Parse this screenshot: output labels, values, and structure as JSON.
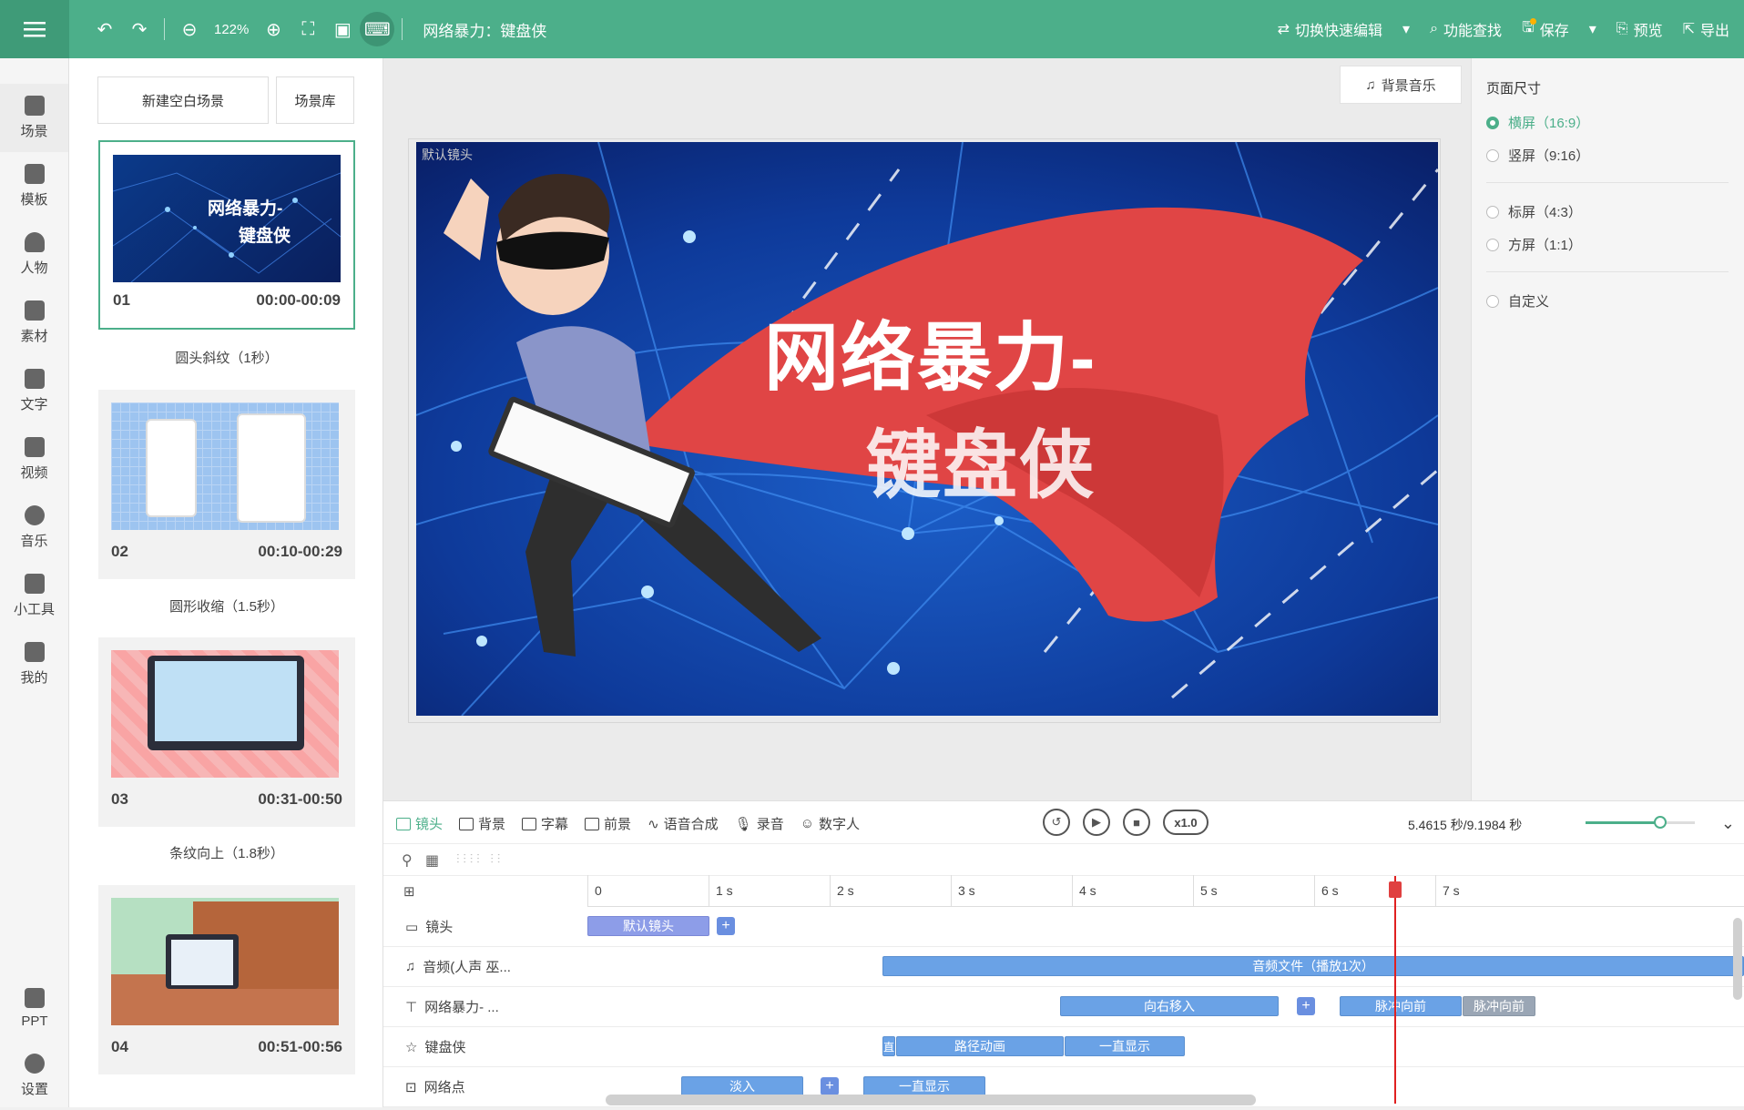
{
  "toolbar": {
    "zoom": "122%",
    "title": "网络暴力：键盘侠",
    "switch_edit": "切换快速编辑",
    "feature_search": "功能查找",
    "save": "保存",
    "preview": "预览",
    "export": "导出",
    "accent": "#4caf8a"
  },
  "nav": [
    {
      "label": "场景",
      "icon": "scene-icon"
    },
    {
      "label": "模板",
      "icon": "template-icon"
    },
    {
      "label": "人物",
      "icon": "person-icon"
    },
    {
      "label": "素材",
      "icon": "material-icon"
    },
    {
      "label": "文字",
      "icon": "text-icon"
    },
    {
      "label": "视频",
      "icon": "video-icon"
    },
    {
      "label": "音乐",
      "icon": "music-icon"
    },
    {
      "label": "小工具",
      "icon": "tools-icon"
    },
    {
      "label": "我的",
      "icon": "mine-icon"
    },
    {
      "label": "PPT",
      "icon": "ppt-icon"
    },
    {
      "label": "设置",
      "icon": "settings-icon"
    }
  ],
  "scenes": {
    "new_blank": "新建空白场景",
    "library": "场景库",
    "items": [
      {
        "num": "01",
        "time": "00:00-00:09",
        "transition": "圆头斜纹（1秒）",
        "thumb_text_1": "网络暴力-",
        "thumb_text_2": "键盘侠"
      },
      {
        "num": "02",
        "time": "00:10-00:29",
        "transition": "圆形收缩（1.5秒）"
      },
      {
        "num": "03",
        "time": "00:31-00:50",
        "transition": "条纹向上（1.8秒）"
      },
      {
        "num": "04",
        "time": "00:51-00:56"
      }
    ]
  },
  "canvas": {
    "bg_music": "背景音乐",
    "camera_label": "默认镜头",
    "headline_1": "网络暴力-",
    "headline_2": "键盘侠"
  },
  "page_size": {
    "title": "页面尺寸",
    "options": [
      {
        "label": "横屏（16:9）",
        "selected": true
      },
      {
        "label": "竖屏（9:16）",
        "selected": false
      },
      {
        "label": "标屏（4:3）",
        "selected": false
      },
      {
        "label": "方屏（1:1）",
        "selected": false
      },
      {
        "label": "自定义",
        "selected": false
      }
    ]
  },
  "timeline": {
    "tabs": [
      "镜头",
      "背景",
      "字幕",
      "前景",
      "语音合成",
      "录音",
      "数字人"
    ],
    "speed": "x1.0",
    "time_readout": "5.4615 秒/9.1984 秒",
    "zoom_level": 0.68,
    "ruler": [
      "0",
      "1 s",
      "2 s",
      "3 s",
      "4 s",
      "5 s",
      "6 s",
      "7 s"
    ],
    "tracks": [
      {
        "name": "镜头",
        "icon": "camera-icon"
      },
      {
        "name": "音频(人声 巫...",
        "icon": "audio-icon"
      },
      {
        "name": "网络暴力-    ...",
        "icon": "text-track-icon"
      },
      {
        "name": "键盘侠",
        "icon": "star-icon"
      },
      {
        "name": "网络点",
        "icon": "image-icon"
      }
    ],
    "clips": {
      "camera": "默认镜头",
      "audio": "音频文件（播放1次）",
      "text_in": "向右移入",
      "text_pulse": "脉冲向前",
      "text_pulse_2": "脉冲向前",
      "kbd_start": "直",
      "kbd_path": "路径动画",
      "kbd_show": "一直显示",
      "dots_fade": "淡入",
      "dots_show": "一直显示"
    }
  }
}
